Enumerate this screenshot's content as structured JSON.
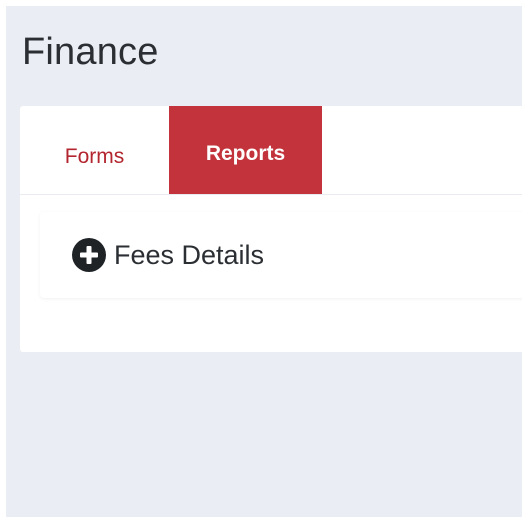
{
  "page": {
    "title": "Finance"
  },
  "tabs": [
    {
      "label": "Forms",
      "active": false
    },
    {
      "label": "Reports",
      "active": true
    }
  ],
  "accordion": {
    "items": [
      {
        "label": "Fees Details",
        "icon": "plus-circle-icon"
      }
    ]
  },
  "colors": {
    "background": "#eaedf3",
    "accent": "#c2333b",
    "inactive_tab_text": "#b3262f",
    "text": "#2b2f33"
  }
}
